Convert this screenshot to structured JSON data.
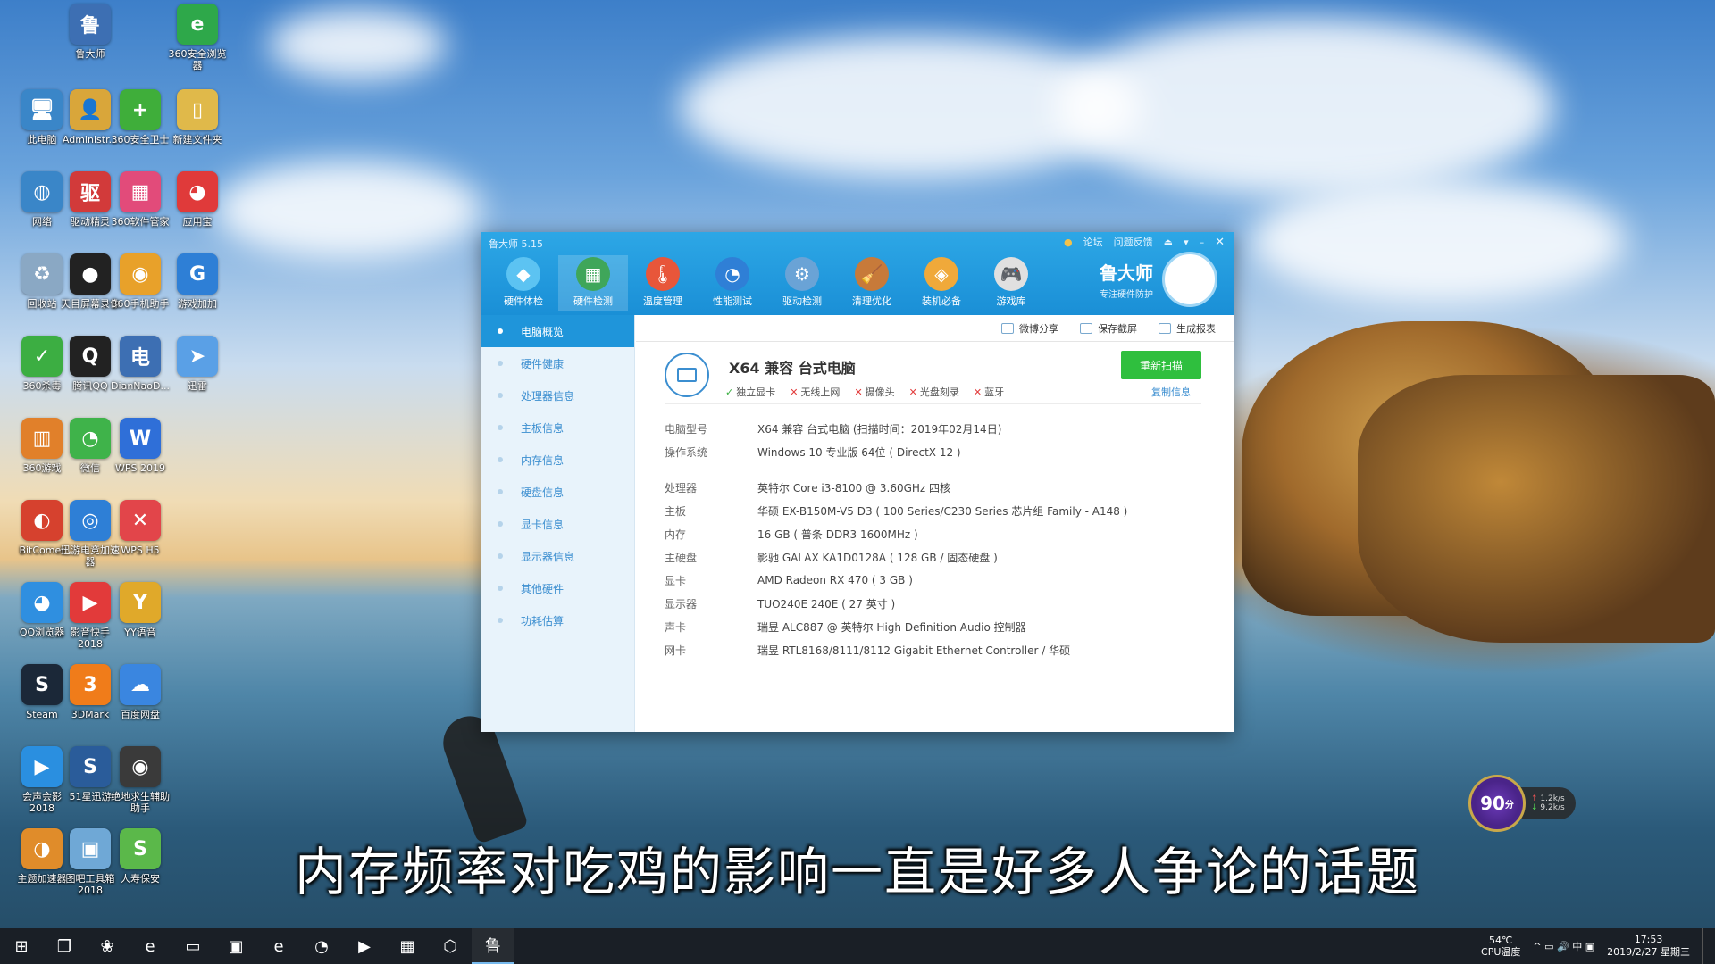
{
  "desktop_icons": [
    {
      "label": "鲁大师",
      "glyph": "鲁",
      "color": "#3d6fb3",
      "icon": "ludashi-icon"
    },
    {
      "label": "360安全浏览器",
      "glyph": "e",
      "color": "#2ea84a",
      "icon": "browser-360-icon"
    },
    {
      "label": "此电脑",
      "glyph": "🖥",
      "color": "#3a86c8",
      "icon": "computer-icon"
    },
    {
      "label": "Administr...",
      "glyph": "👤",
      "color": "#d9a63a",
      "icon": "user-folder-icon"
    },
    {
      "label": "360安全卫士",
      "glyph": "+",
      "color": "#3fae3a",
      "icon": "security-360-icon"
    },
    {
      "label": "新建文件夹",
      "glyph": "▯",
      "color": "#e0b94a",
      "icon": "folder-icon"
    },
    {
      "label": "网络",
      "glyph": "◍",
      "color": "#3a86c8",
      "icon": "network-icon"
    },
    {
      "label": "驱动精灵",
      "glyph": "驱",
      "color": "#d23a3a",
      "icon": "driver-icon"
    },
    {
      "label": "360软件管家",
      "glyph": "▦",
      "color": "#e24b7a",
      "icon": "software-manager-icon"
    },
    {
      "label": "应用宝",
      "glyph": "◕",
      "color": "#e03a3a",
      "icon": "app-store-icon"
    },
    {
      "label": "回收站",
      "glyph": "♻",
      "color": "#8aa8c4",
      "icon": "recycle-bin-icon"
    },
    {
      "label": "天目屏幕录像",
      "glyph": "●",
      "color": "#222222",
      "icon": "screen-recorder-icon"
    },
    {
      "label": "360手机助手",
      "glyph": "◉",
      "color": "#e8a12a",
      "icon": "phone-assistant-icon"
    },
    {
      "label": "游戏加加",
      "glyph": "G",
      "color": "#2e7fd6",
      "icon": "game-plus-icon"
    },
    {
      "label": "360杀毒",
      "glyph": "✓",
      "color": "#3cae42",
      "icon": "antivirus-360-icon"
    },
    {
      "label": "腾讯QQ",
      "glyph": "Q",
      "color": "#222222",
      "icon": "qq-icon"
    },
    {
      "label": "DianNaoD...",
      "glyph": "电",
      "color": "#3d6fb3",
      "icon": "diannaod-icon"
    },
    {
      "label": "迅雷",
      "glyph": "➤",
      "color": "#5aa0e6",
      "icon": "xunlei-icon"
    },
    {
      "label": "360游戏",
      "glyph": "▥",
      "color": "#e1802a",
      "icon": "game-360-icon"
    },
    {
      "label": "微信",
      "glyph": "◔",
      "color": "#3fb34a",
      "icon": "wechat-icon"
    },
    {
      "label": "WPS 2019",
      "glyph": "W",
      "color": "#2f6fd8",
      "icon": "wps-icon"
    },
    {
      "label": "BitComet",
      "glyph": "◐",
      "color": "#d6412e",
      "icon": "bitcomet-icon"
    },
    {
      "label": "迅游电竞加速器",
      "glyph": "◎",
      "color": "#2e7fd6",
      "icon": "xunyou-icon"
    },
    {
      "label": "WPS H5",
      "glyph": "✕",
      "color": "#e2454a",
      "icon": "wps-h5-icon"
    },
    {
      "label": "QQ浏览器",
      "glyph": "◕",
      "color": "#2f8fe0",
      "icon": "qq-browser-icon"
    },
    {
      "label": "影音快手 2018",
      "glyph": "▶",
      "color": "#e23a3a",
      "icon": "video-player-icon"
    },
    {
      "label": "YY语音",
      "glyph": "Y",
      "color": "#e0a92a",
      "icon": "yy-icon"
    },
    {
      "label": "Steam",
      "glyph": "S",
      "color": "#1b2838",
      "icon": "steam-icon"
    },
    {
      "label": "3DMark",
      "glyph": "3",
      "color": "#f07c1a",
      "icon": "3dmark-icon"
    },
    {
      "label": "百度网盘",
      "glyph": "☁",
      "color": "#3a86e0",
      "icon": "baidu-pan-icon"
    },
    {
      "label": "会声会影 2018",
      "glyph": "▶",
      "color": "#2a8fe0",
      "icon": "video-editor-icon"
    },
    {
      "label": "51星迅游",
      "glyph": "S",
      "color": "#2a5c9a",
      "icon": "s51-icon"
    },
    {
      "label": "绝地求生辅助助手",
      "glyph": "◉",
      "color": "#3a3a3a",
      "icon": "pubg-helper-icon"
    },
    {
      "label": "主题加速器",
      "glyph": "◑",
      "color": "#e08c2a",
      "icon": "theme-icon"
    },
    {
      "label": "图吧工具箱 2018",
      "glyph": "▣",
      "color": "#6fa8d6",
      "icon": "toolbox-icon"
    },
    {
      "label": "人寿保安",
      "glyph": "S",
      "color": "#5bb84a",
      "icon": "document-icon"
    }
  ],
  "window": {
    "title": "鲁大师 5.15",
    "ctrl_forum": "论坛",
    "ctrl_feedback": "问题反馈",
    "ctrl_share": "⏏",
    "ctrl_menu": "▾",
    "ctrl_min": "–",
    "ctrl_close": "✕",
    "brand_name": "鲁大师",
    "brand_slogan": "专注硬件防护",
    "tools": [
      {
        "label": "硬件体检",
        "glyph": "◆",
        "icon": "hardware-check-icon"
      },
      {
        "label": "硬件检测",
        "glyph": "▦",
        "icon": "hardware-detect-icon"
      },
      {
        "label": "温度管理",
        "glyph": "🌡",
        "icon": "temperature-icon"
      },
      {
        "label": "性能测试",
        "glyph": "◔",
        "icon": "benchmark-icon"
      },
      {
        "label": "驱动检测",
        "glyph": "⚙",
        "icon": "driver-detect-icon"
      },
      {
        "label": "清理优化",
        "glyph": "🧹",
        "icon": "cleanup-icon"
      },
      {
        "label": "装机必备",
        "glyph": "◈",
        "icon": "essentials-icon"
      },
      {
        "label": "游戏库",
        "glyph": "🎮",
        "icon": "game-library-icon"
      }
    ],
    "active_tool_index": 1,
    "sidebar": [
      "电脑概览",
      "硬件健康",
      "处理器信息",
      "主板信息",
      "内存信息",
      "硬盘信息",
      "显卡信息",
      "显示器信息",
      "其他硬件",
      "功耗估算"
    ],
    "toolbar": {
      "share": "微博分享",
      "save": "保存截屏",
      "report": "生成报表"
    },
    "summary": {
      "title": "X64 兼容 台式电脑",
      "features": [
        {
          "ok": true,
          "label": "独立显卡"
        },
        {
          "ok": false,
          "label": "无线上网"
        },
        {
          "ok": false,
          "label": "摄像头"
        },
        {
          "ok": false,
          "label": "光盘刻录"
        },
        {
          "ok": false,
          "label": "蓝牙"
        }
      ],
      "rescan": "重新扫描",
      "copy": "复制信息"
    },
    "info": [
      {
        "k": "电脑型号",
        "v": "X64 兼容 台式电脑  (扫描时间：2019年02月14日)"
      },
      {
        "k": "操作系统",
        "v": "Windows 10 专业版 64位 ( DirectX 12 )"
      },
      {
        "k": "处理器",
        "v": "英特尔 Core i3-8100 @ 3.60GHz 四核"
      },
      {
        "k": "主板",
        "v": "华硕 EX-B150M-V5 D3 ( 100 Series/C230 Series 芯片组 Family - A148 )"
      },
      {
        "k": "内存",
        "v": "16 GB ( 普条 DDR3 1600MHz )"
      },
      {
        "k": "主硬盘",
        "v": "影驰 GALAX KA1D0128A ( 128 GB / 固态硬盘 )"
      },
      {
        "k": "显卡",
        "v": "AMD Radeon RX 470 ( 3 GB )"
      },
      {
        "k": "显示器",
        "v": "TUO240E 240E ( 27 英寸 )"
      },
      {
        "k": "声卡",
        "v": "瑞昱 ALC887 @ 英特尔 High Definition Audio 控制器"
      },
      {
        "k": "网卡",
        "v": "瑞昱 RTL8168/8111/8112 Gigabit Ethernet Controller / 华硕"
      }
    ]
  },
  "subtitle": "内存频率对吃鸡的影响一直是好多人争论的话题",
  "cpu_widget": {
    "score": "90",
    "unit": "分",
    "up": "1.2k/s",
    "down": "9.2k/s"
  },
  "taskbar": {
    "items": [
      {
        "glyph": "⊞",
        "name": "start-icon"
      },
      {
        "glyph": "❐",
        "name": "task-view-icon"
      },
      {
        "glyph": "❀",
        "name": "taskbar-app-icon"
      },
      {
        "glyph": "e",
        "name": "edge-icon"
      },
      {
        "glyph": "▭",
        "name": "file-explorer-icon"
      },
      {
        "glyph": "▣",
        "name": "store-icon"
      },
      {
        "glyph": "e",
        "name": "browser-360-taskbar-icon"
      },
      {
        "glyph": "◔",
        "name": "qq-browser-taskbar-icon"
      },
      {
        "glyph": "▶",
        "name": "video-taskbar-icon"
      },
      {
        "glyph": "▦",
        "name": "recorder-taskbar-icon"
      },
      {
        "glyph": "⬡",
        "name": "app-taskbar-icon"
      },
      {
        "glyph": "鲁",
        "name": "ludashi-taskbar-icon"
      }
    ],
    "temp": "54℃",
    "temp_label": "CPU温度",
    "tray_icons": "^ ▭ 🔊 中 ▣",
    "time": "17:53",
    "date": "2019/2/27 星期三"
  }
}
